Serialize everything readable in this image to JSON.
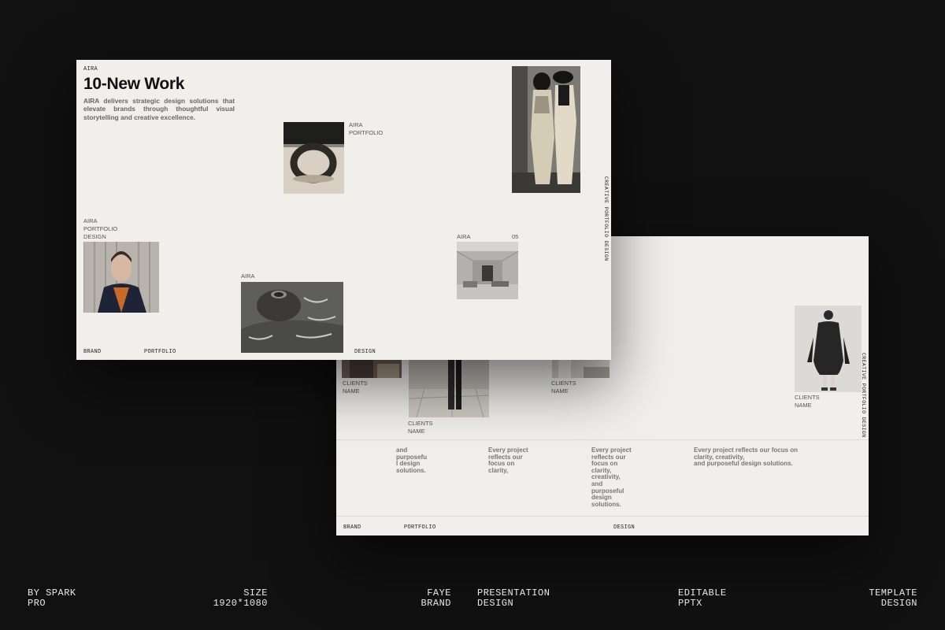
{
  "front_slide": {
    "brand_small": "AIRA",
    "title": "10-New Work",
    "description": "AIRA delivers strategic design solutions that elevate brands through thoughtful visual storytelling and creative excellence.",
    "ring_label": [
      "AIRA",
      "PORTFOLIO"
    ],
    "portrait_label": [
      "AIRA",
      "PORTFOLIO",
      "DESIGN"
    ],
    "vase_label": "AIRA",
    "interior_label": "AIRA",
    "interior_number": "05",
    "vertical_text": "CREATIVE PORTFOLIO DESIGN",
    "footer": {
      "left": "BRAND",
      "middle": "PORTFOLIO",
      "right": "DESIGN"
    }
  },
  "back_slide": {
    "clients": [
      "CLIENTS\nNAME",
      "CLIENTS\nNAME",
      "CLIENTS\nNAME",
      "CLIENTS\nNAME"
    ],
    "texts": [
      "and\npurposefu\nl design\nsolutions.",
      "Every project\nreflects our\nfocus on\nclarity,",
      "Every project\nreflects our\nfocus on\nclarity,\ncreativity,\nand\npurposeful\ndesign\nsolutions.",
      "Every project reflects our focus on\nclarity, creativity,\nand purposeful design solutions."
    ],
    "vertical_text": "CREATIVE PORTFOLIO DESIGN",
    "footer": {
      "left": "BRAND",
      "middle": "PORTFOLIO",
      "right": "DESIGN"
    }
  },
  "footer_captions": [
    {
      "lines": [
        "BY SPARK",
        "PRO"
      ]
    },
    {
      "lines": [
        "SIZE",
        "1920*1080"
      ]
    },
    {
      "lines": [
        "FAYE",
        "BRAND"
      ]
    },
    {
      "lines": [
        "PRESENTATION",
        "DESIGN"
      ]
    },
    {
      "lines": [
        "EDITABLE",
        "PPTX"
      ]
    },
    {
      "lines": [
        "TEMPLATE",
        "DESIGN"
      ]
    }
  ],
  "colors": {
    "background": "#111111",
    "slide": "#f0efec",
    "caption": "#e8e8e8"
  },
  "icons": [
    "ring-sculpture-photo",
    "fashion-duo-photo",
    "portrait-photo",
    "vase-photo",
    "interior-photo",
    "coat-model-photo"
  ]
}
